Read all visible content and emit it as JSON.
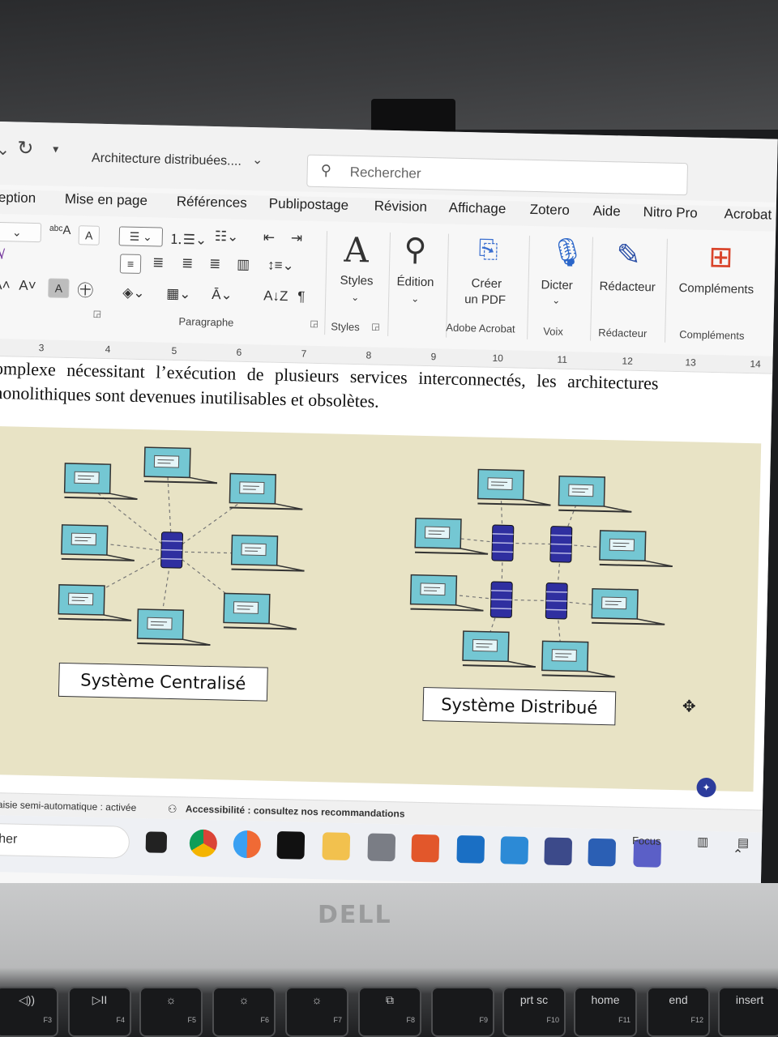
{
  "app": {
    "document_title": "Architecture distribuées....",
    "search_placeholder": "Rechercher"
  },
  "tabs": [
    "eption",
    "Mise en page",
    "Références",
    "Publipostage",
    "Révision",
    "Affichage",
    "Zotero",
    "Aide",
    "Nitro Pro",
    "Acrobat"
  ],
  "ribbon": {
    "paragraph_group": "Paragraphe",
    "styles_label": "Styles",
    "styles_group": "Styles",
    "edition_label": "Édition",
    "create_pdf_line1": "Créer",
    "create_pdf_line2": "un PDF",
    "acrobat_group": "Adobe Acrobat",
    "dicter_label": "Dicter",
    "voix_group": "Voix",
    "redacteur_label": "Rédacteur",
    "redacteur_group": "Rédacteur",
    "complements_label": "Compléments",
    "complements_group": "Compléments"
  },
  "ruler": [
    "3",
    "4",
    "5",
    "6",
    "7",
    "8",
    "9",
    "10",
    "11",
    "12",
    "13",
    "14"
  ],
  "document": {
    "line1": "omplexe nécessitant l’exécution de plusieurs services interconnectés, les architectures",
    "line2": "nonolithiques sont devenues inutilisables et obsolètes.",
    "figure_left_label": "Système Centralisé",
    "figure_right_label": "Système Distribué"
  },
  "statusbar": {
    "autosave": "Saisie semi-automatique : activée",
    "accessibility": "Accessibilité : consultez nos recommandations",
    "focus": "Focus"
  },
  "taskbar": {
    "search_text": "rcher"
  },
  "keys": [
    {
      "main": "◁))",
      "fn": "F3"
    },
    {
      "main": "▷II",
      "fn": "F4"
    },
    {
      "main": "☼",
      "fn": "F5"
    },
    {
      "main": "☼",
      "fn": "F6"
    },
    {
      "main": "☼",
      "fn": "F7"
    },
    {
      "main": "⧉",
      "fn": "F8"
    },
    {
      "main": "",
      "fn": "F9"
    },
    {
      "main": "prt sc",
      "fn": "F10"
    },
    {
      "main": "home",
      "fn": "F11"
    },
    {
      "main": "end",
      "fn": "F12"
    },
    {
      "main": "insert",
      "fn": ""
    }
  ],
  "brand": "DELL",
  "colors": {
    "monitor": "#74c7d3",
    "server": "#2f2fa0",
    "figure_bg": "#e8e3c5"
  }
}
